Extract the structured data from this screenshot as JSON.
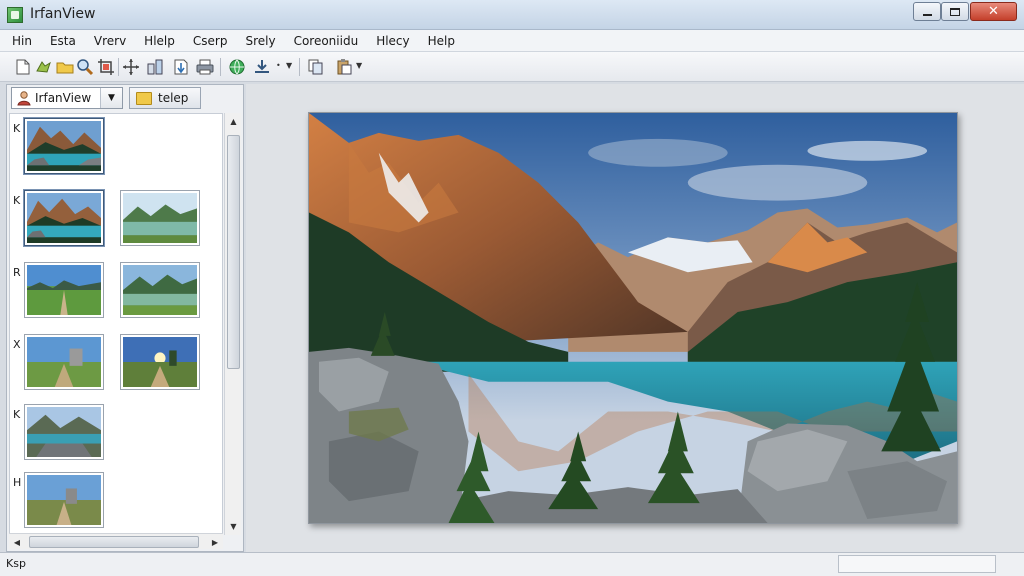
{
  "window": {
    "title": "IrfanView",
    "close_glyph": "✕",
    "minimize_icon": "minimize-icon",
    "maximize_icon": "maximize-icon"
  },
  "menu": [
    "Hin",
    "Esta",
    "Vrerv",
    "Hlelp",
    "Cserp",
    "Srely",
    "Coreoniidu",
    "Hlecy",
    "Help"
  ],
  "toolbar": {
    "icons": [
      "new-file-icon",
      "open-icon",
      "folder-icon",
      "search-icon",
      "crop-icon",
      "move-icon",
      "resize-icon",
      "save-icon",
      "print-icon",
      "globe-icon",
      "download-icon",
      "copy-icon",
      "paste-icon"
    ]
  },
  "left_panel": {
    "combo_label": "IrfanView",
    "tab_label": "telep",
    "row_labels": [
      "K",
      "K",
      "R",
      "X",
      "K",
      "H"
    ]
  },
  "status": {
    "text": "Ksp"
  },
  "colors": {
    "sky_top": "#2f5f9e",
    "lake": "#2fa3b8",
    "forest": "#1e3b26",
    "rock": "#8a8f93",
    "mountain_lit": "#c9743c"
  }
}
